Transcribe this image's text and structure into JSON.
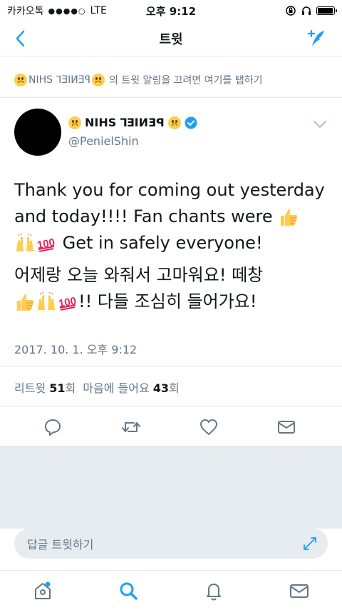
{
  "status_bar": {
    "carrier": "카카오톡",
    "signal": "●●●●○",
    "network": "LTE",
    "time": "오후 9:12",
    "battery_level": 0.95
  },
  "nav": {
    "title": "트윗"
  },
  "notify_banner": {
    "name": "NIHS ꓶƎIИƎꟼ",
    "text": "의 트윗 알림을 끄려면 여기를 탭하기"
  },
  "author": {
    "display_name": "NIHS ꓶƎIИƎꟼ",
    "handle": "@PenielShin",
    "verified": true
  },
  "tweet": {
    "line1": "Thank you for coming out yesterday",
    "line2": "and today!!!! Fan chants were",
    "line3": "Get in safely everyone!",
    "line4": "어제랑 오늘 와줘서 고마워요! 떼창",
    "line5": "!! 다들 조심히 들어가요!",
    "timestamp": "2017. 10. 1. 오후 9:12"
  },
  "stats": {
    "retweet_label": "리트윗",
    "retweet_count": "51",
    "retweet_unit": "회",
    "like_label": "마음에 들어요",
    "like_count": "43",
    "like_unit": "회"
  },
  "reply": {
    "placeholder": "답글 트윗하기"
  },
  "colors": {
    "accent": "#1da1f2",
    "gray_text": "#657786",
    "background_gray": "#e6ecf0"
  },
  "icons": {
    "back": "chevron-left-icon",
    "compose": "compose-feather-icon",
    "reply": "reply-icon",
    "retweet": "retweet-icon",
    "like": "heart-icon",
    "dm": "envelope-icon",
    "home": "home-icon",
    "search": "search-icon",
    "notifications": "bell-icon",
    "messages": "mail-icon"
  }
}
